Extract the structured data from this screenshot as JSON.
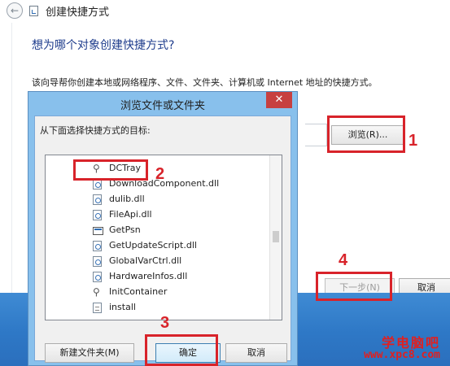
{
  "wizard": {
    "title": "创建快捷方式",
    "question": "想为哪个对象创建快捷方式?",
    "description": "该向导帮你创建本地或网络程序、文件、文件夹、计算机或 Internet 地址的快捷方式。",
    "browse_label": "浏览(R)...",
    "next_label": "下一步(N)",
    "cancel_label": "取消"
  },
  "dialog": {
    "title": "浏览文件或文件夹",
    "close_glyph": "✕",
    "prompt": "从下面选择快捷方式的目标:",
    "items": [
      {
        "label": "DCTray",
        "icon": "run-icon"
      },
      {
        "label": "DownloadComponent.dll",
        "icon": "dll-icon"
      },
      {
        "label": "dulib.dll",
        "icon": "dll-icon"
      },
      {
        "label": "FileApi.dll",
        "icon": "dll-icon"
      },
      {
        "label": "GetPsn",
        "icon": "exe-icon"
      },
      {
        "label": "GetUpdateScript.dll",
        "icon": "dll-icon"
      },
      {
        "label": "GlobalVarCtrl.dll",
        "icon": "dll-icon"
      },
      {
        "label": "HardwareInfos.dll",
        "icon": "dll-icon"
      },
      {
        "label": "InitContainer",
        "icon": "run-icon"
      },
      {
        "label": "install",
        "icon": "text-file-icon"
      }
    ],
    "new_folder_label": "新建文件夹(M)",
    "ok_label": "确定",
    "cancel_label": "取消"
  },
  "annotations": {
    "step1": "1",
    "step2": "2",
    "step3": "3",
    "step4": "4",
    "color": "#d8232a"
  },
  "watermark": {
    "name": "学电脑吧",
    "url": "www.xpc8.com"
  }
}
